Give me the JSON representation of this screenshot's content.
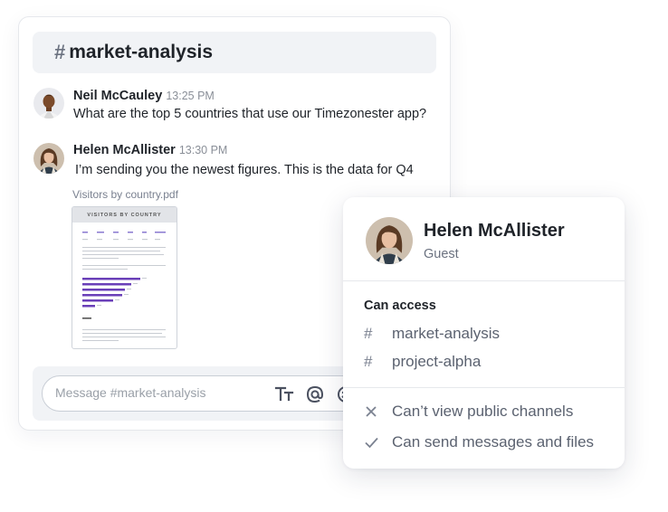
{
  "channel": {
    "hash": "#",
    "name": "market-analysis"
  },
  "messages": [
    {
      "author": "Neil McCauley",
      "time": "13:25 PM",
      "text": "What are the top 5 countries that use our Timezonester app?"
    },
    {
      "author": "Helen McAllister",
      "time": "13:30 PM",
      "text": "I’m sending you the newest figures. This is the data for Q4"
    }
  ],
  "attachment": {
    "filename": "Visitors by country.pdf",
    "preview_heading": "VISITORS BY COUNTRY"
  },
  "composer": {
    "placeholder": "Message #market-analysis"
  },
  "profile": {
    "name": "Helen McAllister",
    "role": "Guest",
    "access_title": "Can access",
    "channels": [
      {
        "icon": "#",
        "name": "market-analysis"
      },
      {
        "icon": "#",
        "name": "project-alpha"
      }
    ],
    "permissions": [
      {
        "icon": "close-icon",
        "text": "Can’t view public channels"
      },
      {
        "icon": "check-icon",
        "text": "Can send messages and files"
      }
    ]
  },
  "colors": {
    "accent_bar": "#6a3fb8",
    "text": "#1f2329",
    "muted": "#6b7280",
    "panel": "#f1f3f6"
  }
}
